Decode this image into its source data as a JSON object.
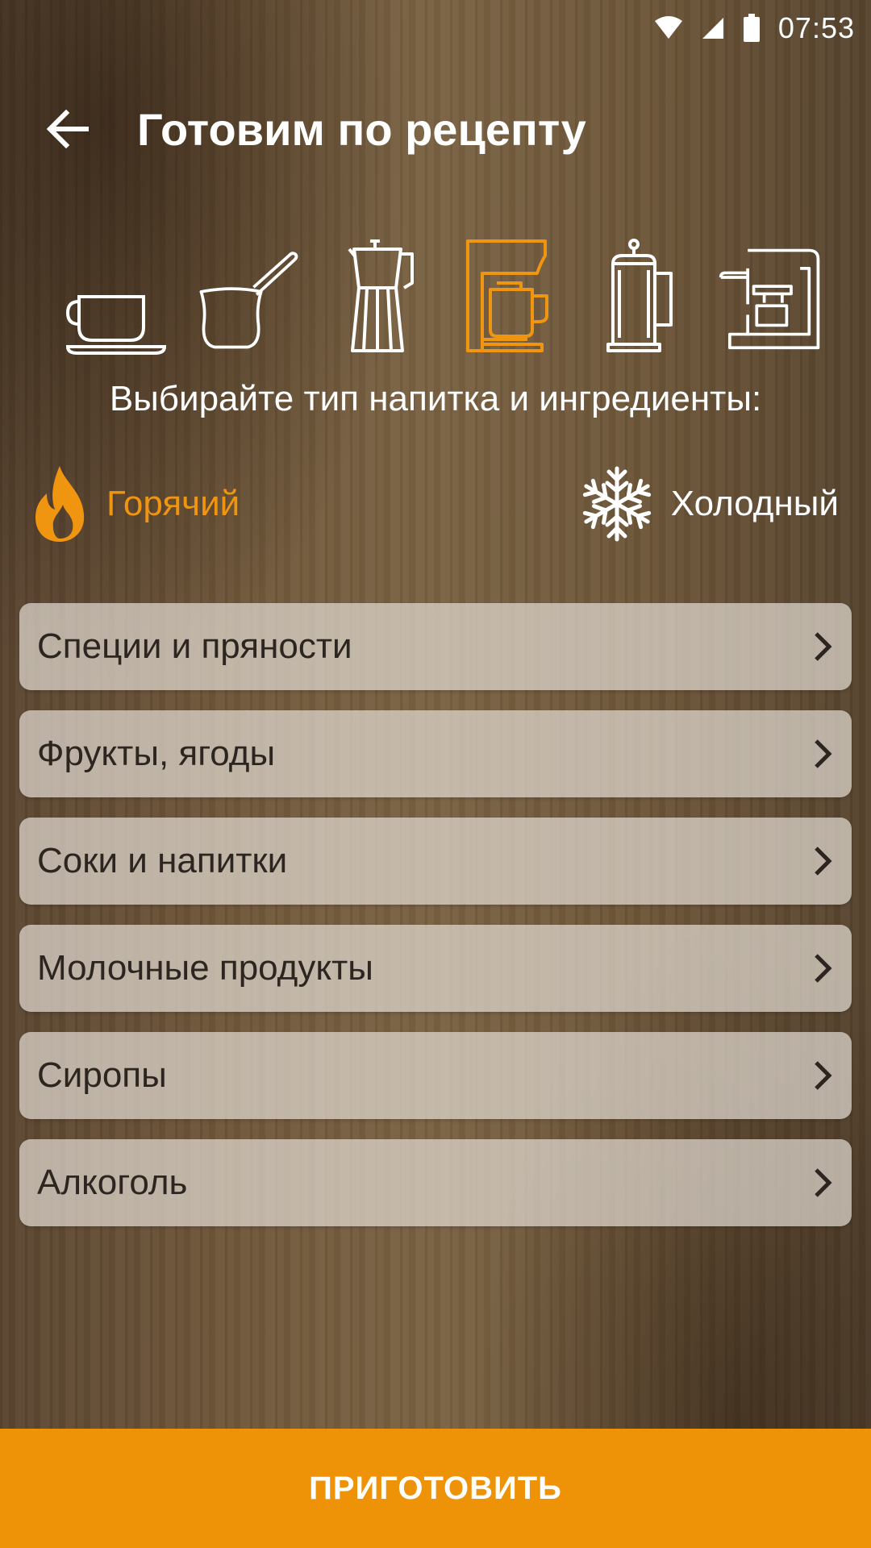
{
  "status_bar": {
    "time": "07:53",
    "icons": [
      "wifi-icon",
      "cellular-signal-icon",
      "battery-icon"
    ]
  },
  "header": {
    "title": "Готовим по рецепту",
    "back_icon": "arrow-back-icon"
  },
  "brew_methods": {
    "items": [
      {
        "icon": "cup-icon",
        "selected": false
      },
      {
        "icon": "turkish-cezve-icon",
        "selected": false
      },
      {
        "icon": "moka-pot-icon",
        "selected": false
      },
      {
        "icon": "drip-coffee-maker-icon",
        "selected": true
      },
      {
        "icon": "french-press-icon",
        "selected": false
      },
      {
        "icon": "espresso-machine-icon",
        "selected": false
      }
    ],
    "selected_color": "#f0950f"
  },
  "subtitle": "Выбирайте тип напитка и ингредиенты:",
  "temperature": {
    "hot": {
      "label": "Горячий",
      "icon": "flame-icon",
      "selected": true
    },
    "cold": {
      "label": "Холодный",
      "icon": "snowflake-icon",
      "selected": false
    }
  },
  "categories": [
    {
      "label": "Специи и пряности"
    },
    {
      "label": "Фрукты, ягоды"
    },
    {
      "label": "Соки и напитки"
    },
    {
      "label": "Молочные продукты"
    },
    {
      "label": "Сиропы"
    },
    {
      "label": "Алкоголь"
    }
  ],
  "action": {
    "label": "ПРИГОТОВИТЬ",
    "color": "#ee9208"
  }
}
